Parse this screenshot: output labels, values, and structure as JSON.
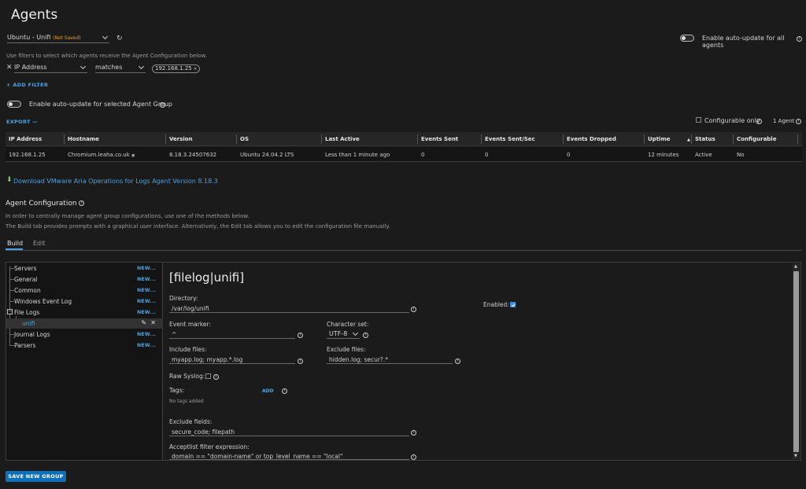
{
  "page": {
    "title": "Agents"
  },
  "group": {
    "name": "Ubuntu - Unifi",
    "unsaved": "(Not Saved)"
  },
  "auto_update_all": {
    "label": "Enable auto-update for all agents",
    "enabled": false
  },
  "filters": {
    "hint": "Use filters to select which agents receive the Agent Configuration below.",
    "field": "IP Address",
    "operator": "matches",
    "value": "192.168.1.25",
    "add_label": "+ ADD FILTER"
  },
  "auto_update_group": {
    "label": "Enable auto-update for selected Agent Group",
    "enabled": false
  },
  "export_label": "EXPORT —",
  "configurable_only_label": "Configurable only",
  "agent_count": "1 Agent",
  "table": {
    "columns": [
      "IP Address",
      "Hostname",
      "Version",
      "OS",
      "Last Active",
      "Events Sent",
      "Events Sent/Sec",
      "Events Dropped",
      "Uptime",
      "Status",
      "Configurable"
    ],
    "rows": [
      [
        "192.168.1.25",
        "Chromium.leaha.co.uk",
        "8.18.3.24507632",
        "Ubuntu 24.04.2 LTS",
        "Less than 1 minute ago",
        "0",
        "0",
        "0",
        "12 minutes",
        "Active",
        "No"
      ]
    ]
  },
  "download_link": "Download VMware Aria Operations for Logs Agent Version 8.18.3",
  "agent_config": {
    "heading": "Agent Configuration",
    "desc1": "In order to centrally manage agent group configurations, use one of the methods below.",
    "desc2": "The Build tab provides prompts with a graphical user interface. Alternatively, the Edit tab allows you to edit the configuration file manually.",
    "tabs": [
      "Build",
      "Edit"
    ],
    "active_tab": "Build"
  },
  "tree": {
    "new_label": "NEW...",
    "items": [
      "Servers",
      "General",
      "Common",
      "Windows Event Log",
      "File Logs",
      "unifi",
      "Journal Logs",
      "Parsers"
    ]
  },
  "form": {
    "section_title": "[filelog|unifi]",
    "directory_label": "Directory:",
    "directory_value": "/var/log/unifi",
    "enabled_label": "Enabled:",
    "enabled": true,
    "event_marker_label": "Event marker:",
    "event_marker_value": "^",
    "charset_label": "Character set:",
    "charset_value": "UTF-8",
    "include_label": "Include files:",
    "include_value": "myapp.log; myapp.*.log",
    "exclude_label": "Exclude files:",
    "exclude_value": "hidden.log; secur?.*",
    "raw_syslog_label": "Raw Syslog:",
    "raw_syslog": false,
    "tags_label": "Tags:",
    "tags_add": "ADD",
    "tags_empty": "No tags added",
    "exclude_fields_label": "Exclude fields:",
    "exclude_fields_value": "secure_code; filepath",
    "acceptlist_label": "Acceptlist filter expression:",
    "acceptlist_value": "domain == \"domain-name\" or top_level_name == \"local\""
  },
  "save_button": "SAVE NEW GROUP",
  "colors": {
    "accent": "#4aa3df",
    "button": "#0e6fb9",
    "warning": "#e0a030",
    "background": "#1b1b1b"
  }
}
